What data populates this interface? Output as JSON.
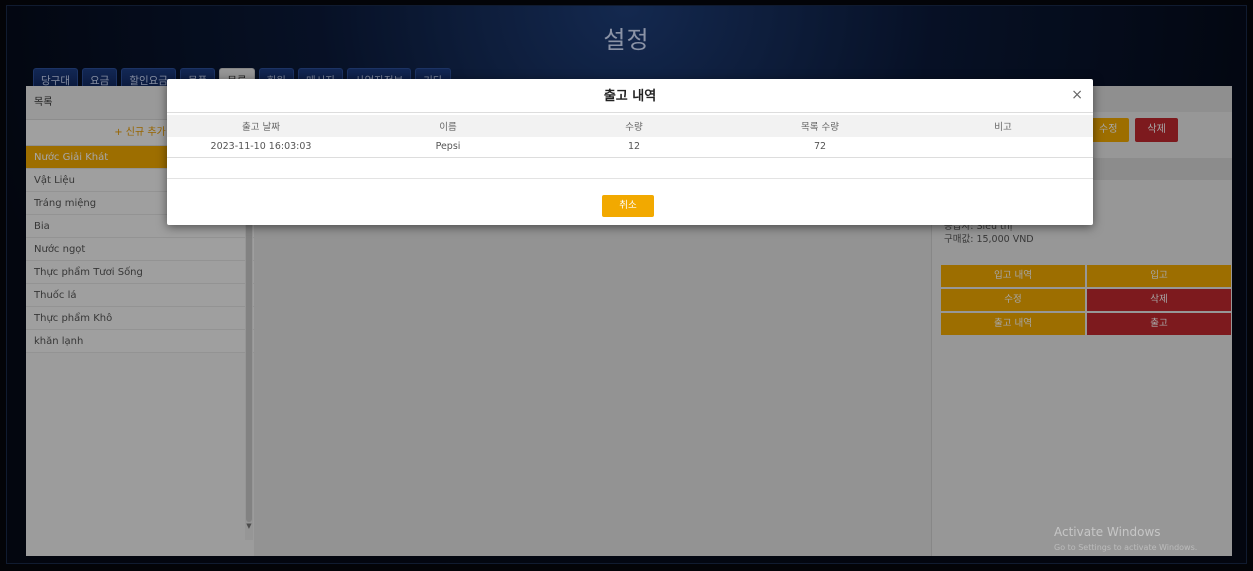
{
  "app": {
    "title": "설정"
  },
  "tabs": [
    {
      "label": "당구대"
    },
    {
      "label": "요금"
    },
    {
      "label": "할인요금"
    },
    {
      "label": "물품"
    },
    {
      "label": "목록"
    },
    {
      "label": "회원"
    },
    {
      "label": "메시지"
    },
    {
      "label": "사업자정보"
    },
    {
      "label": "기타"
    }
  ],
  "sidebar": {
    "header": "목록",
    "add_label": "+ 신규 추가",
    "items": [
      {
        "label": "Nước Giải Khát"
      },
      {
        "label": "Vật Liệu"
      },
      {
        "label": "Tráng miệng"
      },
      {
        "label": "Bia"
      },
      {
        "label": "Nước ngọt"
      },
      {
        "label": "Thực phẩm Tươi Sống"
      },
      {
        "label": "Thuốc lá"
      },
      {
        "label": "Thực phẩm Khô"
      },
      {
        "label": "khăn lạnh"
      }
    ]
  },
  "detail": {
    "edit_label": "수정",
    "delete_label": "삭제",
    "supplier": "공급자: Siêu thị",
    "price": "구매값: 15,000 VND",
    "actions": [
      {
        "label": "입고 내역",
        "color": "#f2a900"
      },
      {
        "label": "입고",
        "color": "#f2a900"
      },
      {
        "label": "수정",
        "color": "#f2a900"
      },
      {
        "label": "삭제",
        "color": "#c0282e"
      },
      {
        "label": "출고 내역",
        "color": "#f2a900"
      },
      {
        "label": "출고",
        "color": "#c0282e"
      }
    ]
  },
  "modal": {
    "title": "출고 내역",
    "close_glyph": "×",
    "columns": [
      "출고 날짜",
      "이름",
      "수량",
      "목록 수량",
      "비고"
    ],
    "rows": [
      [
        "2023-11-10 16:03:03",
        "Pepsi",
        "12",
        "72",
        ""
      ]
    ],
    "cancel_label": "취소"
  },
  "watermark": {
    "line1": "Activate Windows",
    "line2": "Go to Settings to activate Windows."
  },
  "colors": {
    "accent": "#f2a900",
    "danger": "#c0282e"
  }
}
